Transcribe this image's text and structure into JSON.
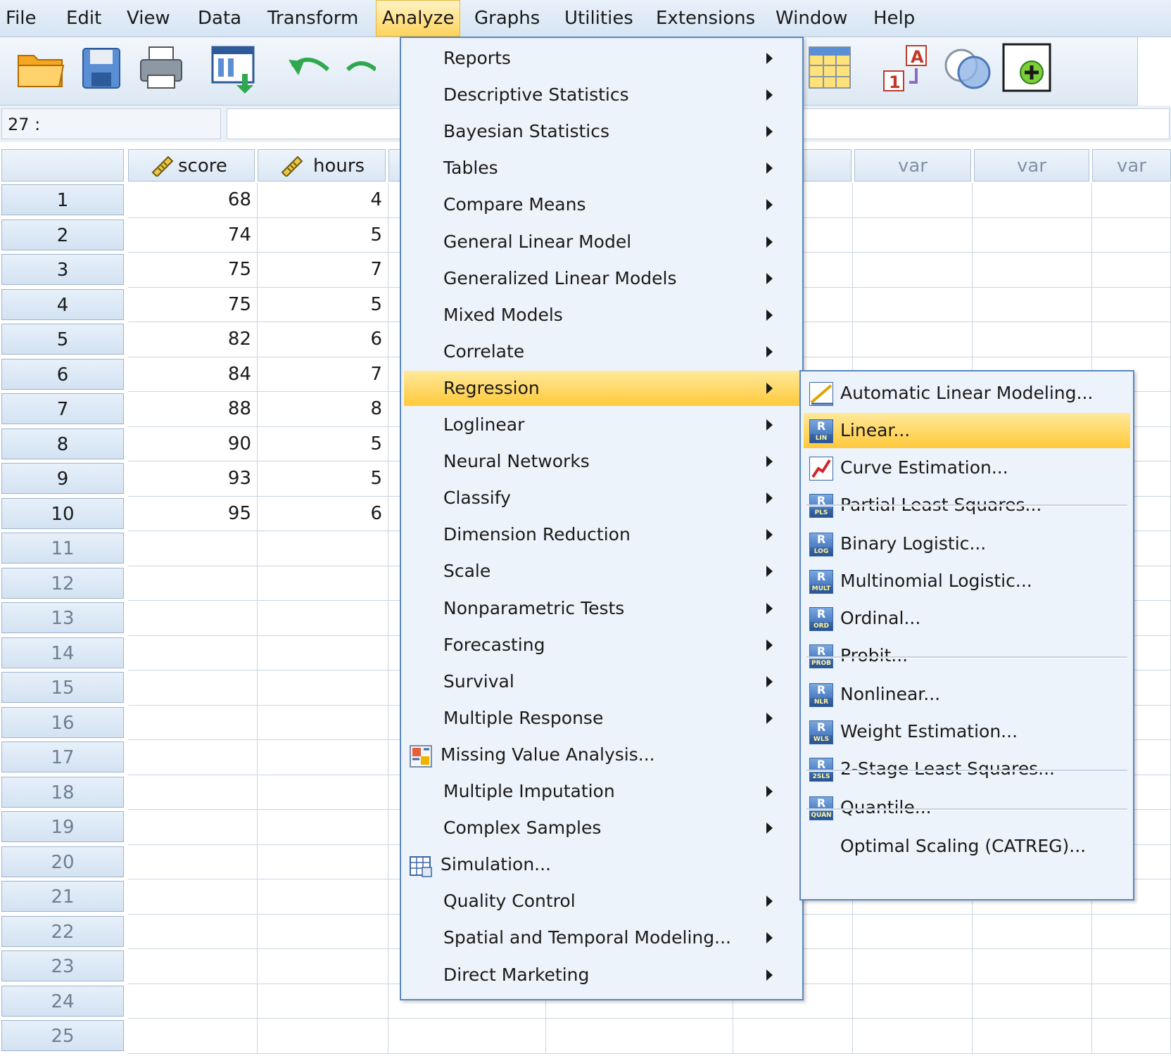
{
  "menubar": {
    "items": [
      "File",
      "Edit",
      "View",
      "Data",
      "Transform",
      "Analyze",
      "Graphs",
      "Utilities",
      "Extensions",
      "Window",
      "Help"
    ],
    "active": "Analyze"
  },
  "toolbar": {
    "icons": [
      "open-folder-icon",
      "save-icon",
      "print-icon",
      "dialog-recall-icon",
      "undo-icon",
      "redo-icon",
      "split-file-icon",
      "select-cases-icon",
      "value-labels-icon",
      "use-sets-icon",
      "add-extension-icon"
    ]
  },
  "refbar": {
    "cell_ref": "27 :",
    "value": ""
  },
  "grid": {
    "columns": [
      "score",
      "hours",
      "",
      "",
      "",
      "var",
      "var",
      "var"
    ],
    "rows": [
      {
        "num": "1",
        "score": "68",
        "hours": "4"
      },
      {
        "num": "2",
        "score": "74",
        "hours": "5"
      },
      {
        "num": "3",
        "score": "75",
        "hours": "7"
      },
      {
        "num": "4",
        "score": "75",
        "hours": "5"
      },
      {
        "num": "5",
        "score": "82",
        "hours": "6"
      },
      {
        "num": "6",
        "score": "84",
        "hours": "7"
      },
      {
        "num": "7",
        "score": "88",
        "hours": "8"
      },
      {
        "num": "8",
        "score": "90",
        "hours": "5"
      },
      {
        "num": "9",
        "score": "93",
        "hours": "5"
      },
      {
        "num": "10",
        "score": "95",
        "hours": "6"
      },
      {
        "num": "11",
        "score": "",
        "hours": ""
      },
      {
        "num": "12",
        "score": "",
        "hours": ""
      },
      {
        "num": "13",
        "score": "",
        "hours": ""
      },
      {
        "num": "14",
        "score": "",
        "hours": ""
      },
      {
        "num": "15",
        "score": "",
        "hours": ""
      },
      {
        "num": "16",
        "score": "",
        "hours": ""
      },
      {
        "num": "17",
        "score": "",
        "hours": ""
      },
      {
        "num": "18",
        "score": "",
        "hours": ""
      },
      {
        "num": "19",
        "score": "",
        "hours": ""
      },
      {
        "num": "20",
        "score": "",
        "hours": ""
      },
      {
        "num": "21",
        "score": "",
        "hours": ""
      },
      {
        "num": "22",
        "score": "",
        "hours": ""
      },
      {
        "num": "23",
        "score": "",
        "hours": ""
      },
      {
        "num": "24",
        "score": "",
        "hours": ""
      },
      {
        "num": "25",
        "score": "",
        "hours": ""
      }
    ]
  },
  "analyze_menu": {
    "items": [
      {
        "label": "Reports",
        "submenu": true
      },
      {
        "label": "Descriptive Statistics",
        "submenu": true
      },
      {
        "label": "Bayesian Statistics",
        "submenu": true
      },
      {
        "label": "Tables",
        "submenu": true
      },
      {
        "label": "Compare Means",
        "submenu": true
      },
      {
        "label": "General Linear Model",
        "submenu": true
      },
      {
        "label": "Generalized Linear Models",
        "submenu": true
      },
      {
        "label": "Mixed Models",
        "submenu": true
      },
      {
        "label": "Correlate",
        "submenu": true
      },
      {
        "label": "Regression",
        "submenu": true,
        "highlighted": true
      },
      {
        "label": "Loglinear",
        "submenu": true
      },
      {
        "label": "Neural Networks",
        "submenu": true
      },
      {
        "label": "Classify",
        "submenu": true
      },
      {
        "label": "Dimension Reduction",
        "submenu": true
      },
      {
        "label": "Scale",
        "submenu": true
      },
      {
        "label": "Nonparametric Tests",
        "submenu": true
      },
      {
        "label": "Forecasting",
        "submenu": true
      },
      {
        "label": "Survival",
        "submenu": true
      },
      {
        "label": "Multiple Response",
        "submenu": true
      },
      {
        "label": "Missing Value Analysis...",
        "submenu": false,
        "icon": "missing-value-icon"
      },
      {
        "label": "Multiple Imputation",
        "submenu": true
      },
      {
        "label": "Complex Samples",
        "submenu": true
      },
      {
        "label": "Simulation...",
        "submenu": false,
        "icon": "simulation-icon"
      },
      {
        "label": "Quality Control",
        "submenu": true
      },
      {
        "label": "Spatial and Temporal Modeling...",
        "submenu": true
      },
      {
        "label": "Direct Marketing",
        "submenu": true
      }
    ]
  },
  "regression_menu": {
    "items": [
      {
        "label": "Automatic Linear Modeling...",
        "icon": "auto-linear-icon",
        "tag": ""
      },
      {
        "label": "Linear...",
        "icon": "linear-regression-icon",
        "tag": "LIN",
        "highlighted": true
      },
      {
        "label": "Curve Estimation...",
        "icon": "curve-estimation-icon",
        "tag": ""
      },
      {
        "label": "Partial Least Squares...",
        "icon": "pls-icon",
        "tag": "PLS"
      },
      {
        "label": "Binary Logistic...",
        "icon": "binary-logistic-icon",
        "tag": "LOG"
      },
      {
        "label": "Multinomial Logistic...",
        "icon": "multinomial-logistic-icon",
        "tag": "MULT"
      },
      {
        "label": "Ordinal...",
        "icon": "ordinal-icon",
        "tag": "ORD"
      },
      {
        "label": "Probit...",
        "icon": "probit-icon",
        "tag": "PROB"
      },
      {
        "label": "Nonlinear...",
        "icon": "nonlinear-icon",
        "tag": "NLR"
      },
      {
        "label": "Weight Estimation...",
        "icon": "weight-estimation-icon",
        "tag": "WLS"
      },
      {
        "label": "2-Stage Least Squares...",
        "icon": "two-stage-icon",
        "tag": "2SLS"
      },
      {
        "label": "Quantile...",
        "icon": "quantile-icon",
        "tag": "QUAN"
      },
      {
        "label": "Optimal Scaling (CATREG)...",
        "icon": "",
        "tag": ""
      }
    ]
  },
  "colors": {
    "menu_highlight": "#ffc93a",
    "menu_border": "#5a86c0",
    "menu_bg": "#edf3fa"
  }
}
